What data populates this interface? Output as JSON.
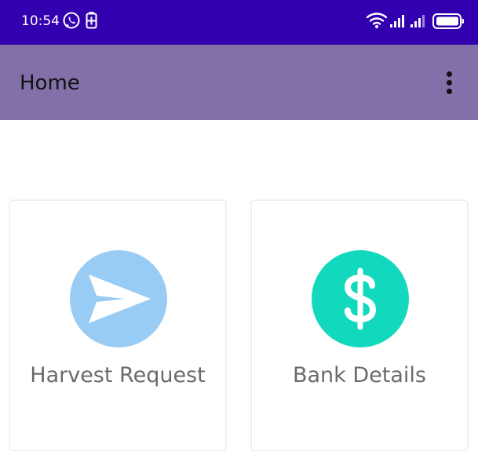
{
  "status_bar": {
    "time": "10:54",
    "background": "#3300b0",
    "icons": [
      "whatsapp-icon",
      "battery-saver-icon",
      "wifi-icon",
      "signal-icon",
      "battery-icon"
    ]
  },
  "app_bar": {
    "title": "Home",
    "background": "#8270a8",
    "menu_icon": "more-vert-icon"
  },
  "cards": [
    {
      "label": "Harvest Request",
      "icon": "send-icon",
      "icon_color": "#99ccf5"
    },
    {
      "label": "Bank Details",
      "icon": "dollar-icon",
      "icon_color": "#12d9bd"
    }
  ]
}
